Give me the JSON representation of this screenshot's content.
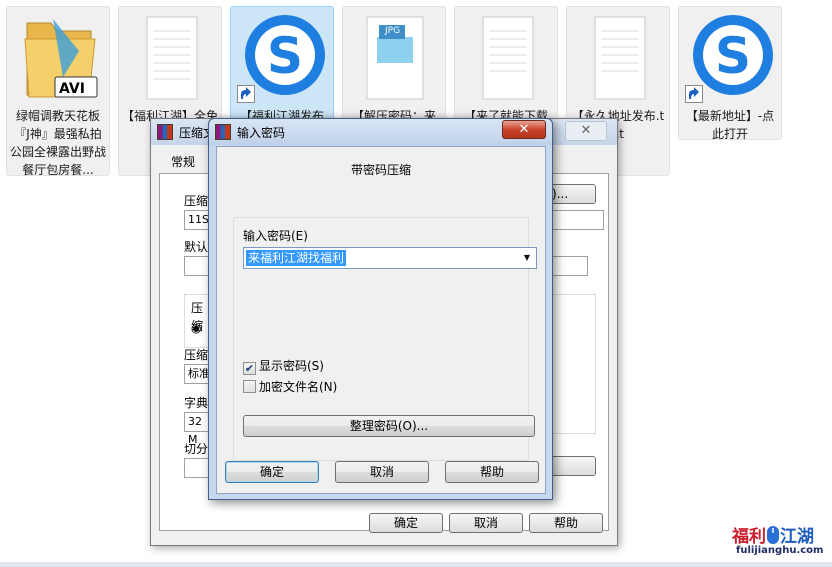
{
  "desktop": {
    "icons": [
      {
        "label": "绿帽调教天花板『J神』最强私拍公园全裸露出野战 餐厅包房餐...",
        "type": "avi-folder",
        "badge": "AVI"
      },
      {
        "label": "【福利江湖】全免费",
        "type": "text-file"
      },
      {
        "label": "【福利江湖发布",
        "type": "sogou-shortcut"
      },
      {
        "label": "【解压密码：来",
        "type": "jpg-file",
        "badge": "JPG"
      },
      {
        "label": "【来了就能下载",
        "type": "text-file"
      },
      {
        "label": "【永久地址发布.txt",
        "type": "text-file"
      },
      {
        "label": "【最新地址】-点此打开",
        "type": "sogou-shortcut"
      }
    ]
  },
  "back_window": {
    "title": "压缩文",
    "tab_general": "常规",
    "labels": {
      "archive": "压缩",
      "archive_value": "11SS",
      "default": "默认",
      "format": "压缩",
      "method": "压缩",
      "method_value": "标准",
      "dict": "字典",
      "dict_value": "32 M",
      "split": "切分"
    },
    "browse_button": "B)...",
    "ok_button": "确定",
    "cancel_button": "取消",
    "help_button": "帮助"
  },
  "dialog": {
    "title": "输入密码",
    "heading": "带密码压缩",
    "password_label": "输入密码(E)",
    "password_value": "来福利江湖找福利",
    "show_password_label": "显示密码(S)",
    "show_password_checked": true,
    "encrypt_names_label": "加密文件名(N)",
    "encrypt_names_checked": false,
    "organize_button": "整理密码(O)...",
    "ok_button": "确定",
    "cancel_button": "取消",
    "help_button": "帮助"
  },
  "watermark": {
    "title_part1": "福利",
    "title_part2": "江湖",
    "url": "fulijianghu.com",
    "colors": {
      "part1": "#c81e2c",
      "part2": "#1d5bbf",
      "mouse": "#2a6fd6"
    }
  }
}
